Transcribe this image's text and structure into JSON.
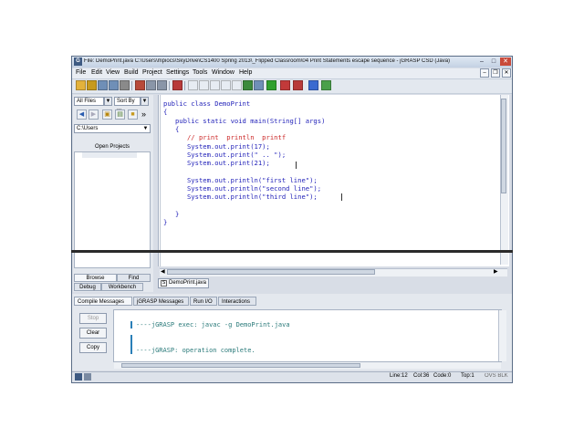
{
  "window": {
    "title": "File: DemoPrint.java  C:\\Users\\mpiocs\\SkyDrive\\CS1400 Spring 2013\\_Flipped Classroom\\04 Print Statements  escape sequence  -  jGRASP CSD (Java)",
    "app_icon": "G",
    "controls": {
      "minimize": "–",
      "maximize": "□",
      "close": "✕"
    }
  },
  "menubar": {
    "items": [
      "File",
      "Edit",
      "View",
      "Build",
      "Project",
      "Settings",
      "Tools",
      "Window",
      "Help"
    ]
  },
  "toolbar": {
    "icons": [
      "open-folder-icon",
      "open-project-icon",
      "save-icon",
      "save-all-icon",
      "print-icon",
      "cut-icon",
      "copy-icon",
      "paste-icon",
      "undo-icon",
      "generate-csd-icon",
      "remove-csd-icon",
      "fold-icon",
      "unfold-icon",
      "number-icon",
      "compile-icon",
      "jar-icon",
      "run-icon",
      "debug-icon",
      "interactions-icon",
      "stop-icon",
      "viewer-icon"
    ]
  },
  "browse": {
    "filter_value": "All Files",
    "sort_value": "Sort By ...",
    "path": "C:\\Users",
    "section_title": "Open Projects",
    "tabs": {
      "browse": "Browse",
      "find": "Find",
      "debug": "Debug",
      "workbench": "Workbench"
    },
    "more": "»"
  },
  "editor": {
    "file_tab": "DemoPrint.java",
    "lines": [
      "public class DemoPrint",
      "{",
      "   public static void main(String[] args)",
      "   {",
      "      // print  println  printf",
      "      System.out.print(17);",
      "      System.out.print(\" .. \");",
      "      System.out.print(21);",
      "",
      "      System.out.println(\"first line\");",
      "      System.out.println(\"second line\");",
      "      System.out.println(\"third line\");",
      "",
      "   }",
      "}"
    ]
  },
  "messages": {
    "tabs": [
      "Compile Messages",
      "jGRASP Messages",
      "Run I/O",
      "Interactions"
    ],
    "active_tab": "Compile Messages",
    "buttons": {
      "stop": "Stop",
      "clear": "Clear",
      "copy": "Copy"
    },
    "lines": [
      "----jGRASP exec: javac -g DemoPrint.java",
      "----jGRASP: operation complete."
    ]
  },
  "status": {
    "line": "Line:12",
    "col": "Col:36",
    "code": "Code:0",
    "top": "Top:1",
    "mode": "OVS BLK"
  },
  "colors": {
    "keyword": "#1f1fb8",
    "comment": "#cc2a2a",
    "message": "#2a7a7a",
    "titlebar": "#c3d1e3",
    "divider": "#2a2a2a"
  }
}
